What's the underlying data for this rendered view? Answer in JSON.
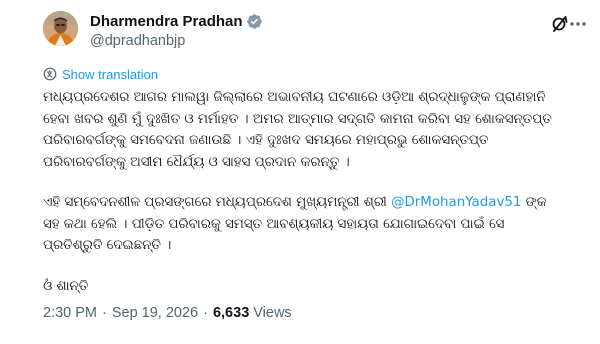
{
  "author": {
    "name": "Dharmendra Pradhan",
    "handle": "@dpradhanbjp",
    "verified_color": "#829aab"
  },
  "icons": {
    "grok": "grok-icon",
    "more": "more-options-icon",
    "translate": "globe-translate-icon",
    "verified": "verified-badge-icon"
  },
  "translation": {
    "label": "Show translation"
  },
  "content": {
    "para1": "ମଧ୍ୟପ୍ରଦେଶର ଆଗର ମାଲୱା ଜିଲ୍ଲାରେ ଅଭାବନୀୟ ଘଟଣାରେ ଓଡ଼ିଆ ଶ୍ରଦ୍ଧାଳୁଙ୍କ ପ୍ରାଣହାନି ହେବା ଖବର ଶୁଣି ମୁଁ ଦୁଃଖିତ ଓ ମର୍ମାହତ । ଅମର ଆତ୍ମାର ସଦ୍‌ଗତି କାମନା କରିବା ସହ ଶୋକସନ୍ତପ୍ତ ପରିବାରବର୍ଗଙ୍କୁ ସମବେଦନା ଜଣାଉଛି । ଏହି ଦୁଃଖଦ ସମୟରେ ମହାପ୍ରଭୁ ଶୋକସନ୍ତପ୍ତ ପରିବାରବର୍ଗଙ୍କୁ ଅସୀମ ଧୈର୍ଯ୍ୟ ଓ ସାହସ ପ୍ରଦାନ କରନ୍ତୁ ।",
    "para2_before": "ଏହି ସମ୍ବେଦନଶୀଳ ପ୍ରସଙ୍ଗରେ ମଧ୍ୟପ୍ରଦେଶ ମୁଖ୍ୟମନ୍ତ୍ରୀ ଶ୍ରୀ ",
    "para2_mention": "@DrMohanYadav51",
    "para2_after": " ଙ୍କ ସହ କଥା ହେଲି । ପୀଡ଼ିତ ପରିବାରକୁ ସମସ୍ତ ଆବଶ୍ୟକୀୟ ସହାୟତା ଯୋଗାଇଦେବା ପାଇଁ ସେ ପ୍ରତିଶ୍ରୁତି ଦେଇଛନ୍ତି ।",
    "para3": "ଓଁ ଶାନ୍ତି"
  },
  "meta": {
    "time": "2:30 PM",
    "separator": "·",
    "date": "Sep 19, 2026",
    "views_count": "6,633",
    "views_label": "Views"
  },
  "colors": {
    "link": "#1d9bf0",
    "secondary": "#536471",
    "text": "#0f1419"
  }
}
